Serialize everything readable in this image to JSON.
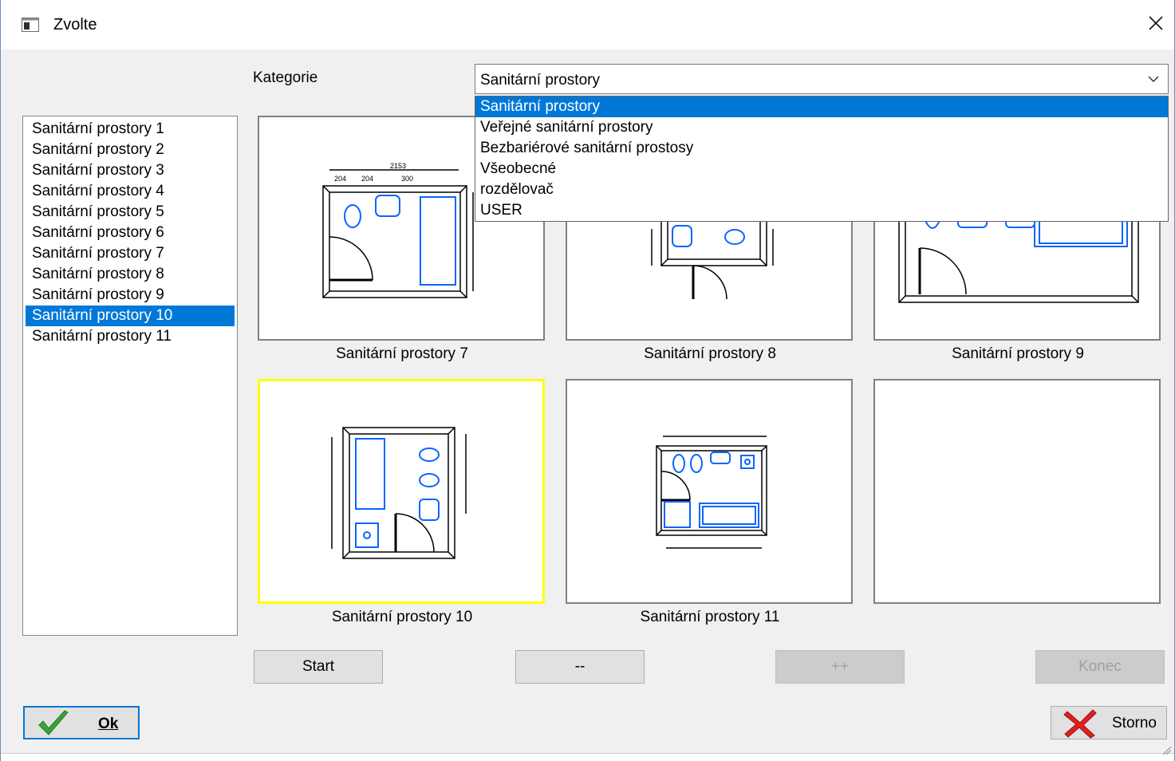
{
  "window": {
    "title": "Zvolte"
  },
  "category": {
    "label": "Kategorie",
    "selected": "Sanitární prostory",
    "options": [
      "Sanitární prostory",
      "Veřejné sanitární prostory",
      "Bezbariérové sanitární prostosy",
      "Všeobecné",
      "rozdělovač",
      "USER"
    ]
  },
  "list": {
    "items": [
      "Sanitární prostory 1",
      "Sanitární prostory 2",
      "Sanitární prostory 3",
      "Sanitární prostory 4",
      "Sanitární prostory 5",
      "Sanitární prostory 6",
      "Sanitární prostory 7",
      "Sanitární prostory 8",
      "Sanitární prostory 9",
      "Sanitární prostory 10",
      "Sanitární prostory 11"
    ],
    "selected_index": 9
  },
  "previews": [
    {
      "caption": "Sanitární prostory 7"
    },
    {
      "caption": "Sanitární prostory 8"
    },
    {
      "caption": "Sanitární prostory 9"
    },
    {
      "caption": "Sanitární prostory 10"
    },
    {
      "caption": "Sanitární prostory 11"
    },
    {
      "caption": ""
    }
  ],
  "nav": {
    "start": "Start",
    "prev": "--",
    "next": "++",
    "end": "Konec"
  },
  "actions": {
    "ok": "Ok",
    "cancel": "Storno"
  },
  "colors": {
    "accent": "#0078d7",
    "highlight": "#ffff00",
    "drawing_blue": "#0a64ff"
  }
}
